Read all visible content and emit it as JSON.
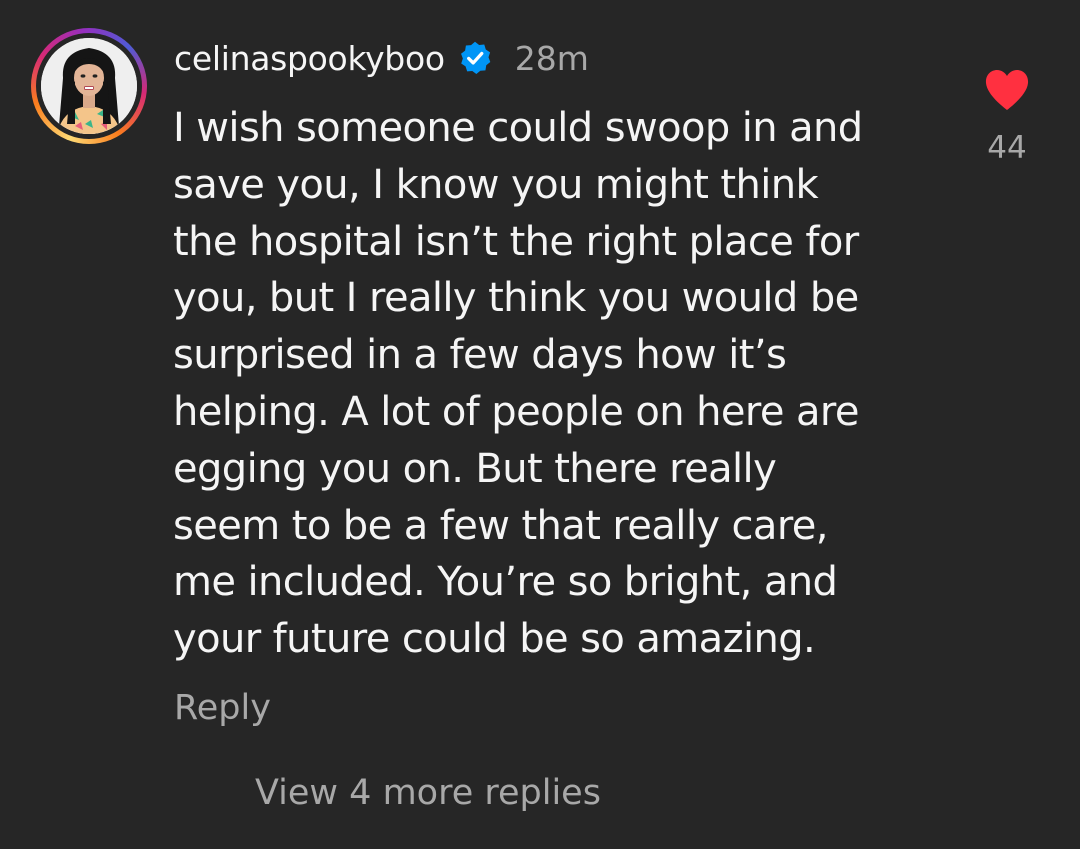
{
  "comment": {
    "username": "celinaspookyboo",
    "verified": true,
    "time": "28m",
    "text_lines": [
      "I wish someone could swoop in and",
      "save you, I know you might think",
      "the hospital isn’t the right place for",
      "you, but I really think you would be",
      "surprised in a few days how it’s",
      "helping. A lot of people on here are",
      "egging you on. But there really",
      "seem to be a few that really care,",
      "me included. You’re so bright, and",
      "your future could be so amazing."
    ],
    "reply_label": "Reply",
    "like_count": "44",
    "liked": true
  },
  "view_more_replies": "View 4 more replies",
  "icons": {
    "like": "heart-icon",
    "verified": "verified-badge-icon"
  },
  "colors": {
    "background": "#262626",
    "text": "#f5f5f5",
    "secondary_text": "#a8a8a8",
    "like": "#ff3040",
    "verified": "#0095f6"
  }
}
